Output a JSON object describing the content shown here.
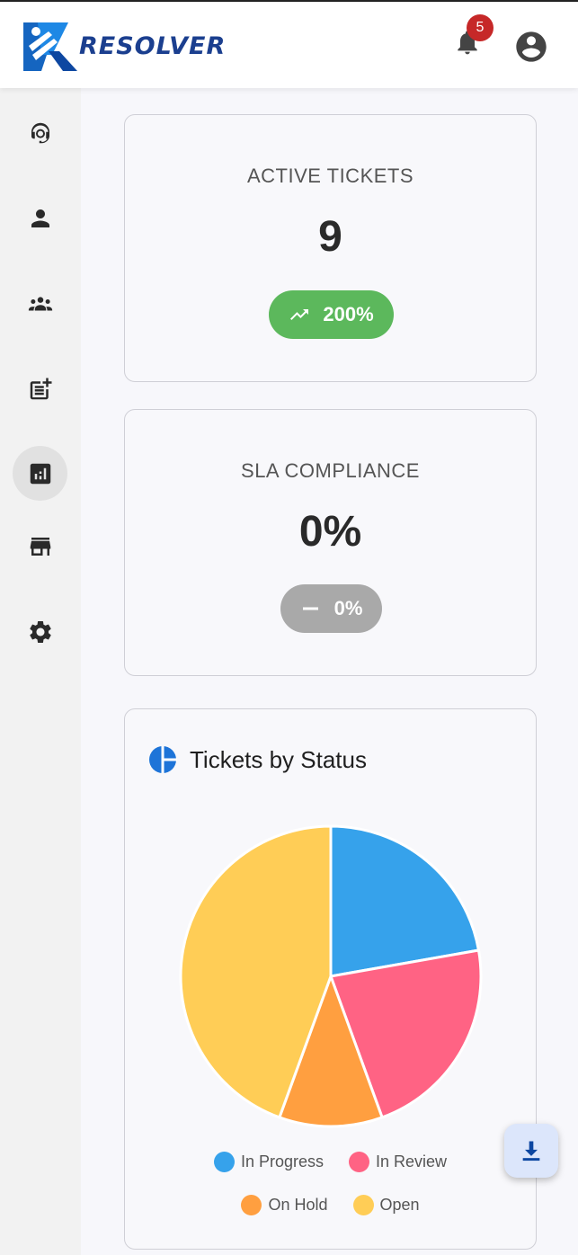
{
  "header": {
    "brand": "RESOLVER",
    "notification_count": "5",
    "colors": {
      "brand_blue": "#1b3f8f",
      "badge_red": "#c62828"
    }
  },
  "sidebar": {
    "items": [
      {
        "icon": "support-agent-icon",
        "active": false
      },
      {
        "icon": "person-icon",
        "active": false
      },
      {
        "icon": "groups-icon",
        "active": false
      },
      {
        "icon": "post-add-icon",
        "active": false
      },
      {
        "icon": "analytics-icon",
        "active": true
      },
      {
        "icon": "store-icon",
        "active": false
      },
      {
        "icon": "settings-icon",
        "active": false
      }
    ]
  },
  "kpis": [
    {
      "title": "ACTIVE TICKETS",
      "value": "9",
      "change": "200%",
      "trend": "up",
      "color": "#5cb85c"
    },
    {
      "title": "SLA COMPLIANCE",
      "value": "0%",
      "change": "0%",
      "trend": "flat",
      "color": "#a9a9a9"
    }
  ],
  "chart_card": {
    "title": "Tickets by Status",
    "icon": "pie-chart-icon"
  },
  "chart_data": {
    "type": "pie",
    "categories": [
      "In Progress",
      "In Review",
      "On Hold",
      "Open"
    ],
    "values": [
      2,
      2,
      1,
      4
    ],
    "colors": [
      "#36a2eb",
      "#ff6384",
      "#ff9f40",
      "#ffcd56"
    ],
    "legend": "bottom"
  },
  "fab": {
    "icon": "download-icon"
  }
}
